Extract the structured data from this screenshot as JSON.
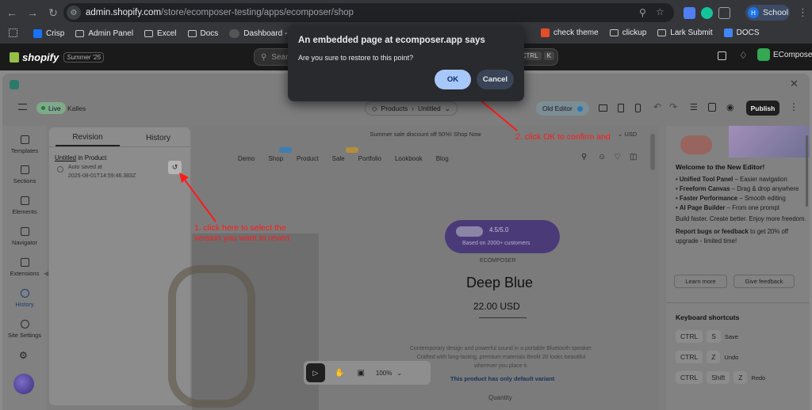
{
  "browser": {
    "url_domain": "admin.shopify.com",
    "url_path": "/store/ecomposer-testing/apps/ecomposer/shop",
    "profile_initial": "H",
    "profile_label": "School",
    "bookmarks": [
      {
        "label": "Crisp",
        "icon": "crisp-icon"
      },
      {
        "label": "Admin Panel",
        "icon": "folder-icon"
      },
      {
        "label": "Excel",
        "icon": "folder-icon"
      },
      {
        "label": "Docs",
        "icon": "folder-icon"
      },
      {
        "label": "Dashboard - EcomEl...",
        "icon": "dashboard-icon"
      },
      {
        "label": "check theme",
        "icon": "html-icon"
      },
      {
        "label": "clickup",
        "icon": "folder-icon"
      },
      {
        "label": "Lark Submit",
        "icon": "folder-icon"
      },
      {
        "label": "DOCS",
        "icon": "docs-icon"
      }
    ]
  },
  "shopify": {
    "brand": "shopify",
    "edition": "Summer '25",
    "search_placeholder": "Search",
    "shortcut": [
      "CTRL",
      "K"
    ],
    "store_name": "EComposer"
  },
  "editor": {
    "status": "Live",
    "theme_name": "Kalles",
    "breadcrumb_type": "Products",
    "breadcrumb_page": "Untitled",
    "old_editor_label": "Old Editor",
    "publish_label": "Publish"
  },
  "rail": [
    "Templates",
    "Sections",
    "Elements",
    "Navigator",
    "Extensions",
    "History",
    "Site Settings"
  ],
  "history_panel": {
    "tabs": [
      "Revision",
      "History"
    ],
    "entry_title_link": "Untitled",
    "entry_title_rest": " in Product",
    "entry_status": "Auto saved at",
    "entry_time": "2025-08-01T14:59:46.383Z"
  },
  "canvas": {
    "announcement": "Summer sale discount off 50%! Shop Now",
    "nav": [
      "Demo",
      "Shop",
      "Product",
      "Sale",
      "Portfolio",
      "Lookbook",
      "Blog"
    ],
    "rating": "4.5/5.0",
    "rating_sub": "Based on 2000+ customers",
    "brand": "ECOMPOSER",
    "product_title": "Deep Blue",
    "price": "22.00 USD",
    "description": "Contemporary design and powerful sound in a portable Bluetooth speaker. Crafted with long-lasting, premium materials Beolit 20 looks beautiful wherever you place it.",
    "variant_note": "This product has only default variant",
    "quantity_label": "Quantity",
    "zoom": "100%"
  },
  "right_panel": {
    "heading": "Welcome to the New Editor!",
    "features": [
      {
        "bold": "Unified Tool Panel",
        "rest": " – Easier navigation"
      },
      {
        "bold": "Freeform Canvas",
        "rest": " – Drag & drop anywhere"
      },
      {
        "bold": "Faster Performance",
        "rest": " – Smooth editing"
      },
      {
        "bold": "AI Page Builder",
        "rest": " – From one prompt"
      }
    ],
    "tagline": "Build faster. Create better. Enjoy more freedom.",
    "report_bold": "Report bugs or feedback",
    "report_rest": " to get 20% off upgrade - limited time!",
    "learn_more": "Learn more",
    "give_feedback": "Give feedback",
    "shortcuts_title": "Keyboard shortcuts",
    "shortcuts": [
      {
        "keys": [
          "CTRL",
          "S"
        ],
        "label": "Save"
      },
      {
        "keys": [
          "CTRL",
          "Z"
        ],
        "label": "Undo"
      },
      {
        "keys": [
          "CTRL",
          "Shift",
          "Z"
        ],
        "label": "Redo"
      }
    ]
  },
  "dialog": {
    "title": "An embedded page at ecomposer.app says",
    "message": "Are you sure to restore to this point?",
    "ok_label": "OK",
    "cancel_label": "Cancel"
  },
  "annotations": {
    "step1": "1. click here to select the version you want to revert",
    "step2": "2. click OK to confirm and",
    "color": "#ff1a1a"
  }
}
